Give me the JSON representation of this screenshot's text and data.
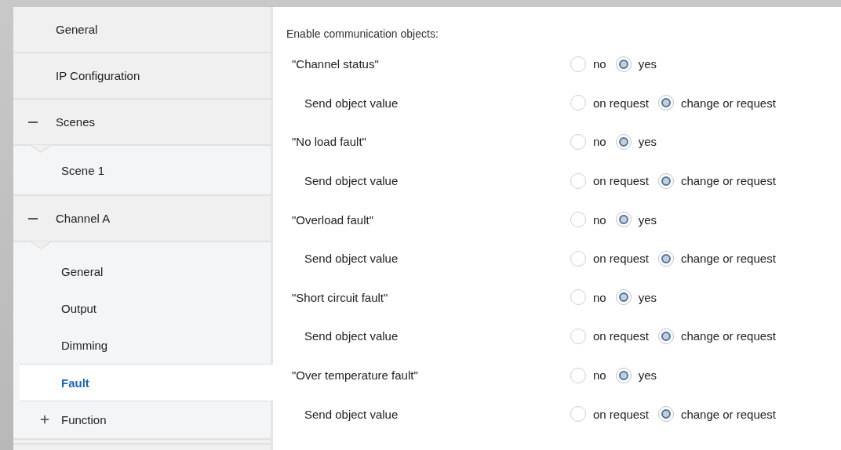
{
  "sidebar": {
    "items": [
      {
        "label": "General",
        "selected": false
      },
      {
        "label": "IP Configuration",
        "selected": false
      },
      {
        "label": "Scenes",
        "selected": false,
        "expanded": true,
        "children": [
          {
            "label": "Scene 1",
            "selected": false
          }
        ]
      },
      {
        "label": "Channel A",
        "selected": false,
        "expanded": true,
        "children": [
          {
            "label": "General",
            "selected": false
          },
          {
            "label": "Output",
            "selected": false
          },
          {
            "label": "Dimming",
            "selected": false
          },
          {
            "label": "Fault",
            "selected": true
          },
          {
            "label": "Function",
            "selected": false,
            "expanded": false
          }
        ]
      }
    ]
  },
  "panel": {
    "heading": "Enable communication objects:",
    "rows": [
      {
        "kind": "main",
        "label": "\"Channel status\"",
        "options": [
          {
            "label": "no",
            "selected": false
          },
          {
            "label": "yes",
            "selected": true
          }
        ]
      },
      {
        "kind": "sub",
        "label": "Send object value",
        "options": [
          {
            "label": "on request",
            "selected": false
          },
          {
            "label": "change or request",
            "selected": true
          }
        ]
      },
      {
        "kind": "main",
        "label": "\"No load fault\"",
        "options": [
          {
            "label": "no",
            "selected": false
          },
          {
            "label": "yes",
            "selected": true
          }
        ]
      },
      {
        "kind": "sub",
        "label": "Send object value",
        "options": [
          {
            "label": "on request",
            "selected": false
          },
          {
            "label": "change or request",
            "selected": true
          }
        ]
      },
      {
        "kind": "main",
        "label": "\"Overload fault\"",
        "options": [
          {
            "label": "no",
            "selected": false
          },
          {
            "label": "yes",
            "selected": true
          }
        ]
      },
      {
        "kind": "sub",
        "label": "Send object value",
        "options": [
          {
            "label": "on request",
            "selected": false
          },
          {
            "label": "change or request",
            "selected": true
          }
        ]
      },
      {
        "kind": "main",
        "label": "\"Short circuit fault\"",
        "options": [
          {
            "label": "no",
            "selected": false
          },
          {
            "label": "yes",
            "selected": true
          }
        ]
      },
      {
        "kind": "sub",
        "label": "Send object value",
        "options": [
          {
            "label": "on request",
            "selected": false
          },
          {
            "label": "change or request",
            "selected": true
          }
        ]
      },
      {
        "kind": "main",
        "label": "\"Over temperature fault\"",
        "options": [
          {
            "label": "no",
            "selected": false
          },
          {
            "label": "yes",
            "selected": true
          }
        ]
      },
      {
        "kind": "sub",
        "label": "Send object value",
        "options": [
          {
            "label": "on request",
            "selected": false
          },
          {
            "label": "change or request",
            "selected": true
          }
        ]
      }
    ]
  }
}
